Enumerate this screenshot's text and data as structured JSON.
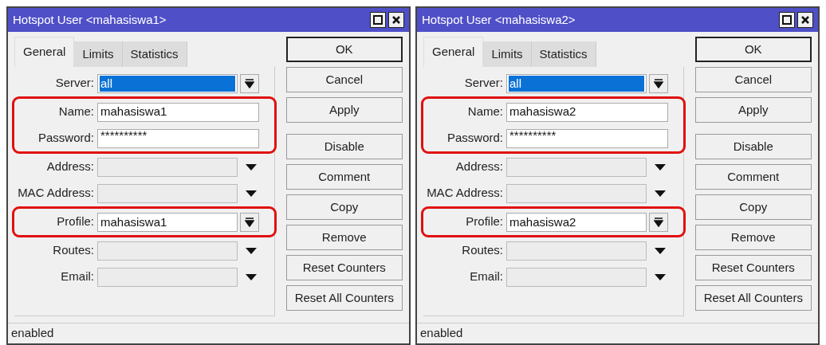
{
  "windows": [
    {
      "title": "Hotspot User <mahasiswa1>",
      "tabs": [
        {
          "label": "General",
          "selected": true
        },
        {
          "label": "Limits",
          "selected": false
        },
        {
          "label": "Statistics",
          "selected": false
        }
      ],
      "fields": [
        {
          "label": "Server:",
          "kind": "select",
          "value": "all",
          "value_selected": true,
          "highlighted": false
        },
        {
          "label": "Name:",
          "kind": "text",
          "value": "mahasiswa1",
          "highlighted": true
        },
        {
          "label": "Password:",
          "kind": "password",
          "value": "**********",
          "highlighted": true
        },
        {
          "label": "Address:",
          "kind": "dropdown",
          "highlighted": false
        },
        {
          "label": "MAC Address:",
          "kind": "dropdown",
          "highlighted": false
        },
        {
          "label": "Profile:",
          "kind": "select",
          "value": "mahasiswa1",
          "value_selected": false,
          "highlighted": true
        },
        {
          "label": "Routes:",
          "kind": "dropdown",
          "highlighted": false
        },
        {
          "label": "Email:",
          "kind": "dropdown",
          "highlighted": false
        }
      ],
      "buttons": [
        {
          "label": "OK",
          "default": true
        },
        {
          "label": "Cancel",
          "default": false
        },
        {
          "label": "Apply",
          "default": false,
          "gap_after": true
        },
        {
          "label": "Disable",
          "default": false
        },
        {
          "label": "Comment",
          "default": false
        },
        {
          "label": "Copy",
          "default": false
        },
        {
          "label": "Remove",
          "default": false
        },
        {
          "label": "Reset Counters",
          "default": false
        },
        {
          "label": "Reset All Counters",
          "default": false
        }
      ],
      "status": "enabled"
    },
    {
      "title": "Hotspot User <mahasiswa2>",
      "tabs": [
        {
          "label": "General",
          "selected": true
        },
        {
          "label": "Limits",
          "selected": false
        },
        {
          "label": "Statistics",
          "selected": false
        }
      ],
      "fields": [
        {
          "label": "Server:",
          "kind": "select",
          "value": "all",
          "value_selected": true,
          "highlighted": false
        },
        {
          "label": "Name:",
          "kind": "text",
          "value": "mahasiswa2",
          "highlighted": true
        },
        {
          "label": "Password:",
          "kind": "password",
          "value": "**********",
          "highlighted": true
        },
        {
          "label": "Address:",
          "kind": "dropdown",
          "highlighted": false
        },
        {
          "label": "MAC Address:",
          "kind": "dropdown",
          "highlighted": false
        },
        {
          "label": "Profile:",
          "kind": "select",
          "value": "mahasiswa2",
          "value_selected": false,
          "highlighted": true
        },
        {
          "label": "Routes:",
          "kind": "dropdown",
          "highlighted": false
        },
        {
          "label": "Email:",
          "kind": "dropdown",
          "highlighted": false
        }
      ],
      "buttons": [
        {
          "label": "OK",
          "default": true
        },
        {
          "label": "Cancel",
          "default": false
        },
        {
          "label": "Apply",
          "default": false,
          "gap_after": true
        },
        {
          "label": "Disable",
          "default": false
        },
        {
          "label": "Comment",
          "default": false
        },
        {
          "label": "Copy",
          "default": false
        },
        {
          "label": "Remove",
          "default": false
        },
        {
          "label": "Reset Counters",
          "default": false
        },
        {
          "label": "Reset All Counters",
          "default": false
        }
      ],
      "status": "enabled"
    }
  ]
}
